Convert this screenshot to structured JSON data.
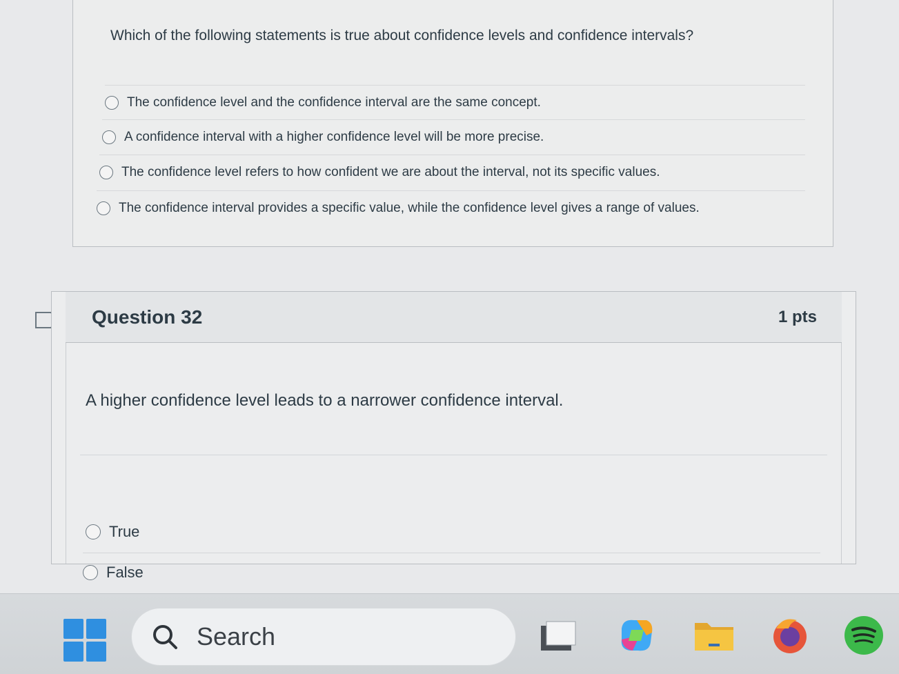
{
  "question31": {
    "text": "Which of the following statements is true about confidence levels and confidence intervals?",
    "answers": [
      "The confidence level and the confidence interval are the same concept.",
      "A confidence interval with a higher confidence level will be more precise.",
      "The confidence level refers to how confident we are about the interval, not its specific values.",
      "The confidence interval provides a specific value, while the confidence level gives a range of values."
    ]
  },
  "question32": {
    "title": "Question 32",
    "points": "1 pts",
    "text": "A higher confidence level leads to a narrower confidence interval.",
    "answers": [
      "True",
      "False"
    ]
  },
  "taskbar": {
    "search_placeholder": "Search",
    "apps": [
      "start-icon",
      "task-view-icon",
      "copilot-icon",
      "file-explorer-icon",
      "firefox-icon",
      "spotify-icon"
    ],
    "accent": "#2f8fe0"
  }
}
